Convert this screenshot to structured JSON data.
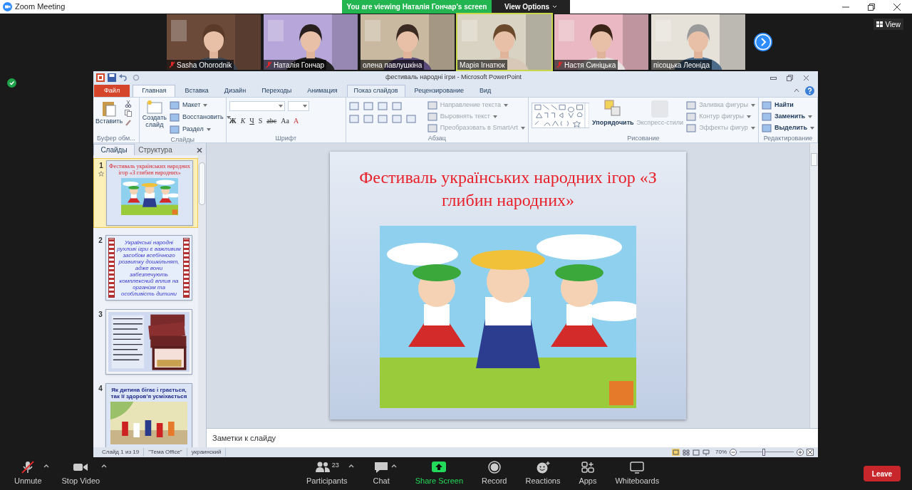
{
  "window": {
    "title": "Zoom Meeting"
  },
  "share_banner": {
    "text": "You are viewing Наталія Гончар's screen",
    "options_label": "View Options"
  },
  "participants": [
    {
      "name": "Sasha Ohorodnik",
      "muted": true,
      "speaking": false
    },
    {
      "name": "Наталія Гончар",
      "muted": true,
      "speaking": false
    },
    {
      "name": "олена павлушкіна",
      "muted": false,
      "speaking": false
    },
    {
      "name": "Марія Ігнатюк",
      "muted": false,
      "speaking": true
    },
    {
      "name": "Настя Синіцька",
      "muted": true,
      "speaking": false
    },
    {
      "name": "пісоцька Леоніда",
      "muted": false,
      "speaking": false
    }
  ],
  "view_button": "View",
  "powerpoint": {
    "title": "фестиваль народні ігри - Microsoft PowerPoint",
    "tabs": [
      {
        "label": "Файл",
        "kind": "file",
        "selected": false,
        "hovered": false
      },
      {
        "label": "Главная",
        "kind": "tab",
        "selected": true,
        "hovered": false
      },
      {
        "label": "Вставка",
        "kind": "tab",
        "selected": false,
        "hovered": false
      },
      {
        "label": "Дизайн",
        "kind": "tab",
        "selected": false,
        "hovered": false
      },
      {
        "label": "Переходы",
        "kind": "tab",
        "selected": false,
        "hovered": false
      },
      {
        "label": "Анимация",
        "kind": "tab",
        "selected": false,
        "hovered": false
      },
      {
        "label": "Показ слайдов",
        "kind": "tab",
        "selected": false,
        "hovered": true
      },
      {
        "label": "Рецензирование",
        "kind": "tab",
        "selected": false,
        "hovered": false
      },
      {
        "label": "Вид",
        "kind": "tab",
        "selected": false,
        "hovered": false
      }
    ],
    "ribbon": {
      "clipboard": {
        "label": "Буфер обм...",
        "paste": "Вставить"
      },
      "slides": {
        "label": "Слайды",
        "new_slide": "Создать слайд",
        "commands": [
          "Макет",
          "Восстановить",
          "Раздел"
        ]
      },
      "font": {
        "label": "Шрифт",
        "format_buttons": [
          "Ж",
          "К",
          "Ч",
          "S",
          "abc",
          "Aa",
          "A"
        ]
      },
      "paragraph": {
        "label": "Абзац",
        "commands": [
          {
            "label": "Направление текста",
            "disabled": true
          },
          {
            "label": "Выровнять текст",
            "disabled": true
          },
          {
            "label": "Преобразовать в SmartArt",
            "disabled": true
          }
        ]
      },
      "drawing": {
        "label": "Рисование",
        "arrange": "Упорядочить",
        "quick_styles": {
          "label": "Экспресс-стили",
          "disabled": true
        },
        "commands": [
          {
            "label": "Заливка фигуры",
            "disabled": true
          },
          {
            "label": "Контур фигуры",
            "disabled": true
          },
          {
            "label": "Эффекты фигур",
            "disabled": true
          }
        ]
      },
      "editing": {
        "label": "Редактирование",
        "commands": [
          "Найти",
          "Заменить",
          "Выделить"
        ]
      }
    },
    "panel_tabs": [
      {
        "label": "Слайды",
        "selected": true
      },
      {
        "label": "Структура",
        "selected": false
      }
    ],
    "thumbnails": [
      {
        "number": "1",
        "selected": true,
        "kind": "title",
        "text": "Фестиваль українських народних ігор «З глибин народних»"
      },
      {
        "number": "2",
        "selected": false,
        "kind": "text",
        "text": "Українські народні рухливі ігри є важливим засобом всебічного розвитку дошкільнят, адже вони забезпечують комплексний вплив на організм та особливість дитини"
      },
      {
        "number": "3",
        "selected": false,
        "kind": "collage"
      },
      {
        "number": "4",
        "selected": false,
        "text": "Як дитина бігає і грається, так її здоров'я усміхається"
      }
    ],
    "slide": {
      "title": "Фестиваль українських народних ігор «З глибин народних»"
    },
    "notes_placeholder": "Заметки к слайду",
    "status": [
      "Слайд 1 из 19",
      "\"Тема Office\"",
      "украинский"
    ],
    "zoom": {
      "label": "70%",
      "level": 0.45
    }
  },
  "toolbar": [
    {
      "label": "Unmute",
      "kind": "mic",
      "caret": true
    },
    {
      "label": "Stop Video",
      "kind": "video",
      "caret": true
    },
    {
      "label": "Participants",
      "kind": "participants",
      "count": "23",
      "caret": true
    },
    {
      "label": "Chat",
      "kind": "chat",
      "caret": true
    },
    {
      "label": "Share Screen",
      "kind": "share",
      "caret": false
    },
    {
      "label": "Record",
      "kind": "record",
      "caret": false
    },
    {
      "label": "Reactions",
      "kind": "reactions",
      "caret": false
    },
    {
      "label": "Apps",
      "kind": "apps",
      "caret": false
    },
    {
      "label": "Whiteboards",
      "kind": "whiteboard",
      "caret": false
    }
  ],
  "leave": "Leave"
}
